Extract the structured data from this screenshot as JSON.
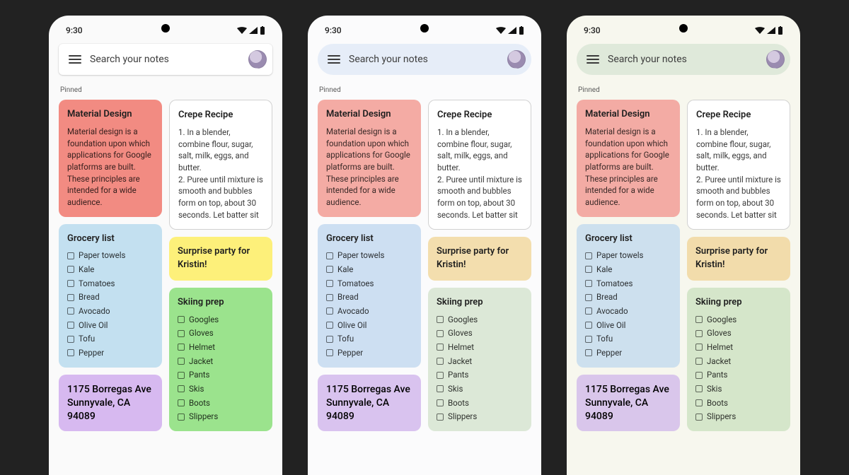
{
  "status": {
    "time": "9:30"
  },
  "search": {
    "placeholder": "Search your notes"
  },
  "sections": {
    "pinned_label": "Pinned"
  },
  "notes": {
    "material": {
      "title": "Material Design",
      "body": "Material design is a foundation upon which applications for Google platforms are built. These principles are intended for a wide audience."
    },
    "crepe": {
      "title": "Crepe Recipe",
      "bodyA": "1. In a blender, combine flour, sugar, salt, milk, eggs, and butter.\n2. Puree until mixture is smooth and bubbles form on top, about 30 seconds. Let batter sit",
      "bodyB": "1. In a blender, combine flour, sugar, salt, milk, eggs, and butter.\n2. Puree until mixture is smooth and bubbles form on top, about 30 seconds. Let batter sit"
    },
    "grocery": {
      "title": "Grocery list",
      "items": [
        "Paper towels",
        "Kale",
        "Tomatoes",
        "Bread",
        "Avocado",
        "Olive Oil",
        "Tofu",
        "Pepper"
      ]
    },
    "surprise": {
      "title": "Surprise party for Kristin!"
    },
    "skiing": {
      "title": "Skiing prep",
      "items": [
        "Googles",
        "Gloves",
        "Helmet",
        "Jacket",
        "Pants",
        "Skis",
        "Boots",
        "Slippers"
      ]
    },
    "address": {
      "body": "1175 Borregas Ave Sunnyvale, CA 94089"
    }
  }
}
